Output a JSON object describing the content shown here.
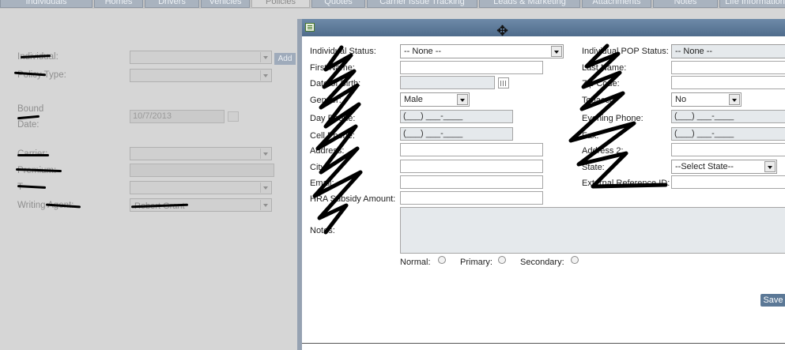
{
  "tabs": [
    {
      "label": "Individuals"
    },
    {
      "label": "Homes"
    },
    {
      "label": "Drivers"
    },
    {
      "label": "Vehicles"
    },
    {
      "label": "Policies",
      "active": true
    },
    {
      "label": "Quotes"
    },
    {
      "label": "Carrier Issue Tracking"
    },
    {
      "label": "Leads & Marketing"
    },
    {
      "label": "Attachments"
    },
    {
      "label": "Notes"
    },
    {
      "label": "Life Information"
    }
  ],
  "background_form": {
    "individual_label": "Individual:",
    "policy_type_label": "Policy Type:",
    "bound_label": "Bound",
    "date_label": "Date:",
    "bound_date_value": "10/7/2013",
    "carrier_label": "Carrier:",
    "premium_label": "Premium:",
    "t_label": "T",
    "writing_agent_label": "Writing Agent:",
    "writing_agent_value": "Robert Grant",
    "add_button": "Add"
  },
  "modal": {
    "title": "",
    "move_icon": "move-icon",
    "fields": {
      "individual_status": {
        "label": "Individual Status:",
        "value": "-- None --"
      },
      "individual_pop_status": {
        "label": "Individual POP Status:",
        "value": "-- None --"
      },
      "first_name": {
        "label": "First Name:",
        "value": ""
      },
      "last_name": {
        "label": "Last Name:",
        "value": ""
      },
      "date_of_birth": {
        "label": "Date of Birth:",
        "value": ""
      },
      "zip_code": {
        "label": "Zip Code:",
        "value": ""
      },
      "gender": {
        "label": "Gender:",
        "value": "Male"
      },
      "tobacco": {
        "label": "Tobacco:",
        "value": "No"
      },
      "day_phone": {
        "label": "Day Phone:",
        "value": "(___) ___-____"
      },
      "evening_phone": {
        "label": "Evening Phone:",
        "value": "(___) ___-____"
      },
      "cell_phone": {
        "label": "Cell Phone:",
        "value": "(___) ___-____"
      },
      "fax": {
        "label": "Fax:",
        "value": "(___) ___-____"
      },
      "address": {
        "label": "Address:",
        "value": ""
      },
      "address2": {
        "label": "Address 2:",
        "value": ""
      },
      "city": {
        "label": "City:",
        "value": ""
      },
      "state": {
        "label": "State:",
        "value": "--Select State--"
      },
      "email": {
        "label": "Email:",
        "value": ""
      },
      "external_reference_id": {
        "label": "External Reference ID:",
        "value": ""
      },
      "hra_subsidy_amount": {
        "label": "HRA Subsidy Amount:",
        "value": ""
      },
      "notes": {
        "label": "Notes:",
        "value": ""
      }
    },
    "radios": {
      "normal": "Normal:",
      "primary": "Primary:",
      "secondary": "Secondary:"
    },
    "save_button": "Save"
  }
}
